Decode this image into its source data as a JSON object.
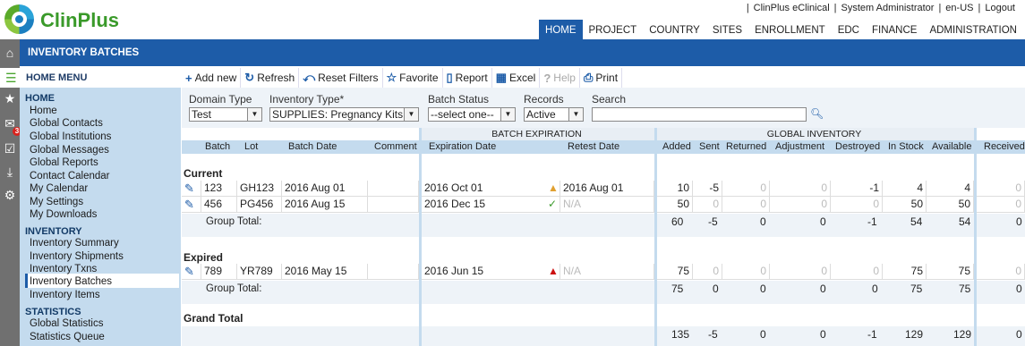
{
  "app": {
    "name": "ClinPlus"
  },
  "top_links": [
    "ClinPlus eClinical",
    "System Administrator",
    "en-US",
    "Logout"
  ],
  "top_nav": [
    {
      "label": "HOME",
      "active": true
    },
    {
      "label": "PROJECT"
    },
    {
      "label": "COUNTRY"
    },
    {
      "label": "SITES"
    },
    {
      "label": "ENROLLMENT"
    },
    {
      "label": "EDC"
    },
    {
      "label": "FINANCE"
    },
    {
      "label": "ADMINISTRATION"
    }
  ],
  "page_title": "INVENTORY BATCHES",
  "notification_count": "3",
  "menu_title": "HOME MENU",
  "sidebar": {
    "home_header": "HOME",
    "home_items": [
      "Home",
      "Global Contacts",
      "Global Institutions",
      "Global Messages",
      "Global Reports",
      "Contact Calendar",
      "My Calendar",
      "My Settings",
      "My Downloads"
    ],
    "inventory_header": "INVENTORY",
    "inventory_items": [
      "Inventory Summary",
      "Inventory Shipments",
      "Inventory Txns",
      "Inventory Batches",
      "Inventory Items"
    ],
    "statistics_header": "STATISTICS",
    "statistics_items": [
      "Global Statistics",
      "Statistics Queue"
    ],
    "selected": "Inventory Batches"
  },
  "toolbar": [
    {
      "label": "Add new",
      "icon": "plus-icon"
    },
    {
      "label": "Refresh",
      "icon": "refresh-icon"
    },
    {
      "label": "Reset Filters",
      "icon": "reset-filter-icon"
    },
    {
      "label": "Favorite",
      "icon": "star-icon"
    },
    {
      "label": "Report",
      "icon": "report-icon"
    },
    {
      "label": "Excel",
      "icon": "excel-icon"
    },
    {
      "label": "Help",
      "icon": "help-icon",
      "disabled": true
    },
    {
      "label": "Print",
      "icon": "print-icon"
    }
  ],
  "filters": {
    "domain_type": {
      "label": "Domain Type",
      "value": "Test"
    },
    "inventory_type": {
      "label": "Inventory Type*",
      "value": "SUPPLIES: Pregnancy Kits"
    },
    "batch_status": {
      "label": "Batch Status",
      "value": "--select one--"
    },
    "records": {
      "label": "Records",
      "value": "Active"
    },
    "search": {
      "label": "Search",
      "value": ""
    }
  },
  "grid": {
    "group_headers": {
      "batch_expiration": "BATCH EXPIRATION",
      "global_inventory": "GLOBAL INVENTORY"
    },
    "columns": [
      "Batch",
      "Lot",
      "Batch Date",
      "Comment",
      "Expiration Date",
      "Retest Date",
      "Added",
      "Sent",
      "Returned",
      "Adjustment",
      "Destroyed",
      "In Stock",
      "Available",
      "Received"
    ],
    "groups": [
      {
        "name": "Current",
        "rows": [
          {
            "batch": "123",
            "lot": "GH123",
            "batch_date": "2016 Aug 01",
            "comment": "",
            "expiration": "2016 Oct 01",
            "status_icon": "warning-triangle-icon",
            "status_color": "#e0a030",
            "retest": "2016 Aug 01",
            "retest_na": false,
            "added": "10",
            "sent": "-5",
            "returned": "0",
            "adjustment": "0",
            "destroyed": "-1",
            "in_stock": "4",
            "available": "4",
            "received": "0"
          },
          {
            "batch": "456",
            "lot": "PG456",
            "batch_date": "2016 Aug 15",
            "comment": "",
            "expiration": "2016 Dec 15",
            "status_icon": "check-icon",
            "status_color": "#3a9a2a",
            "retest": "N/A",
            "retest_na": true,
            "added": "50",
            "sent": "0",
            "returned": "0",
            "adjustment": "0",
            "destroyed": "0",
            "in_stock": "50",
            "available": "50",
            "received": "0"
          }
        ],
        "total_label": "Group Total:",
        "total": {
          "added": "60",
          "sent": "-5",
          "returned": "0",
          "adjustment": "0",
          "destroyed": "-1",
          "in_stock": "54",
          "available": "54",
          "received": "0"
        }
      },
      {
        "name": "Expired",
        "rows": [
          {
            "batch": "789",
            "lot": "YR789",
            "batch_date": "2016 May 15",
            "comment": "",
            "expiration": "2016 Jun 15",
            "status_icon": "expired-triangle-icon",
            "status_color": "#cc1111",
            "retest": "N/A",
            "retest_na": true,
            "added": "75",
            "sent": "0",
            "returned": "0",
            "adjustment": "0",
            "destroyed": "0",
            "in_stock": "75",
            "available": "75",
            "received": "0"
          }
        ],
        "total_label": "Group Total:",
        "total": {
          "added": "75",
          "sent": "0",
          "returned": "0",
          "adjustment": "0",
          "destroyed": "0",
          "in_stock": "75",
          "available": "75",
          "received": "0"
        }
      }
    ],
    "grand_total_label": "Grand Total",
    "grand_total": {
      "added": "135",
      "sent": "-5",
      "returned": "0",
      "adjustment": "0",
      "destroyed": "-1",
      "in_stock": "129",
      "available": "129",
      "received": "0"
    }
  }
}
